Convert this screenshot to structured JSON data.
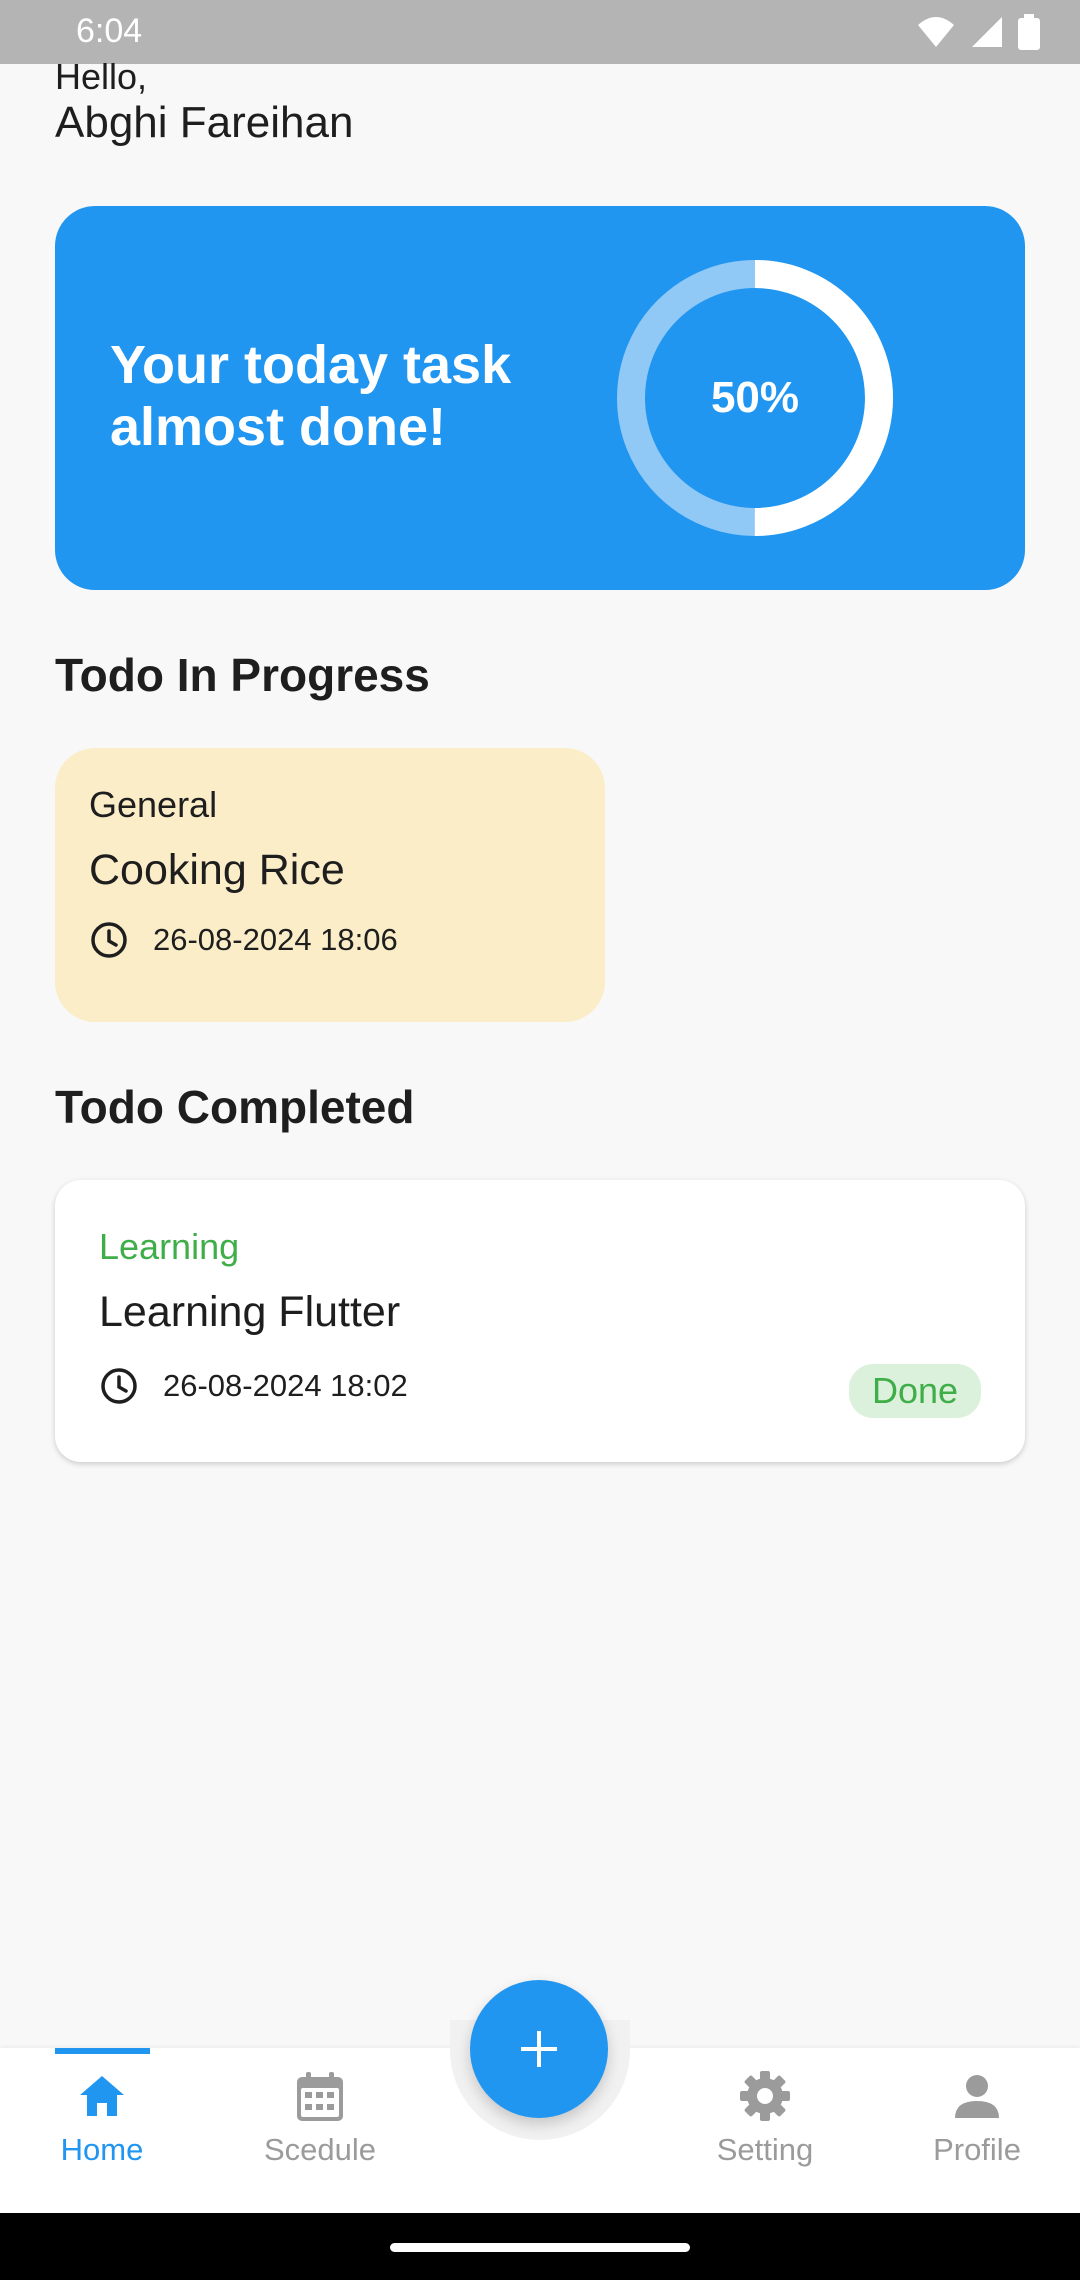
{
  "status_bar": {
    "time": "6:04"
  },
  "greeting": {
    "hello": "Hello,",
    "name": "Abghi Fareihan"
  },
  "progress_card": {
    "message": "Your today task almost done!",
    "percent_label": "50%",
    "progress_fraction": 0.5
  },
  "sections": {
    "in_progress_title": "Todo In Progress",
    "completed_title": "Todo Completed"
  },
  "in_progress": {
    "category": "General",
    "title": "Cooking Rice",
    "time": "26-08-2024 18:06"
  },
  "completed": {
    "category": "Learning",
    "title": "Learning Flutter",
    "time": "26-08-2024 18:02",
    "status": "Done"
  },
  "bottom_nav": {
    "items": [
      {
        "label": "Home",
        "icon": "home-icon",
        "active": true
      },
      {
        "label": "Scedule",
        "icon": "calendar-icon",
        "active": false
      },
      {
        "label": "Setting",
        "icon": "gear-icon",
        "active": false
      },
      {
        "label": "Profile",
        "icon": "person-icon",
        "active": false
      }
    ],
    "fab_icon": "plus-icon"
  },
  "colors": {
    "primary": "#2196f0",
    "progress_card_bg": "#2196f0",
    "in_progress_bg": "#faedc8",
    "success": "#3fae48",
    "inactive": "#9b9b9b"
  }
}
